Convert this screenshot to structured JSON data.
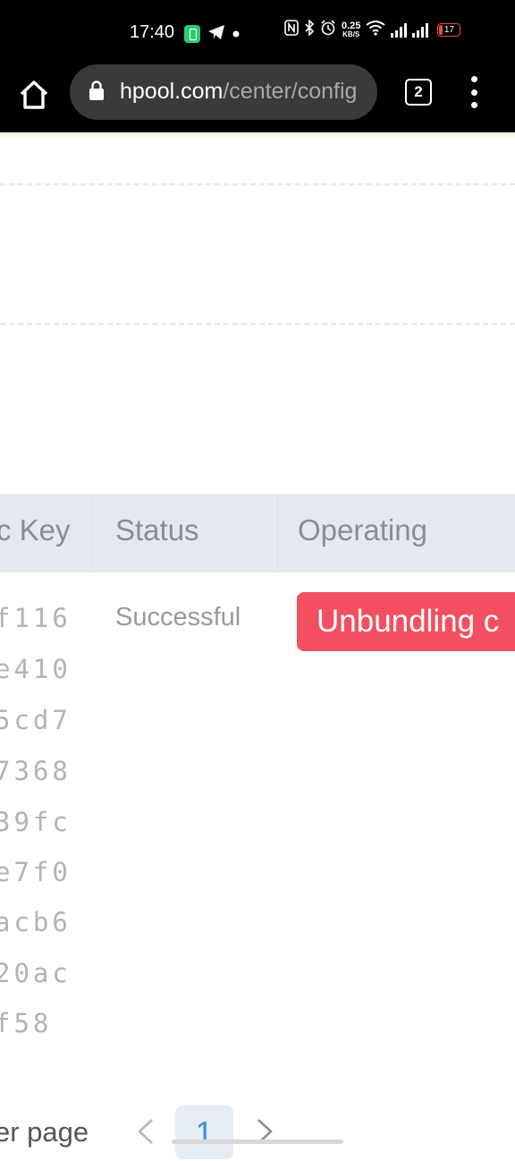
{
  "status_bar": {
    "time": "17:40",
    "net_speed_value": "0.25",
    "net_speed_unit": "KB/S",
    "battery_level": "17",
    "battery_fraction": 0.17,
    "icons": [
      "battery-saver-icon",
      "telegram-icon",
      "dot-icon",
      "nfc-icon",
      "bluetooth-icon",
      "alarm-icon",
      "wifi-icon",
      "signal-icon",
      "signal-icon",
      "battery-icon"
    ]
  },
  "browser": {
    "url_domain": "hpool.com",
    "url_path": "/center/config",
    "tab_count": "2"
  },
  "table": {
    "headers": {
      "key": "c Key",
      "status": "Status",
      "operating": "Operating"
    },
    "key_fragments": [
      "f116",
      "e410",
      "5cd7",
      "7368",
      "39fc",
      "e7f0",
      "acb6",
      "20ac",
      "f58"
    ],
    "status_value": "Successful",
    "unbundle_label": "Unbundling c"
  },
  "pagination": {
    "per_page_label": "er page",
    "current_page": "1"
  },
  "colors": {
    "accent_red": "#f25060",
    "page_blue": "#3a8ee6",
    "header_bg": "#e4e8f0"
  }
}
